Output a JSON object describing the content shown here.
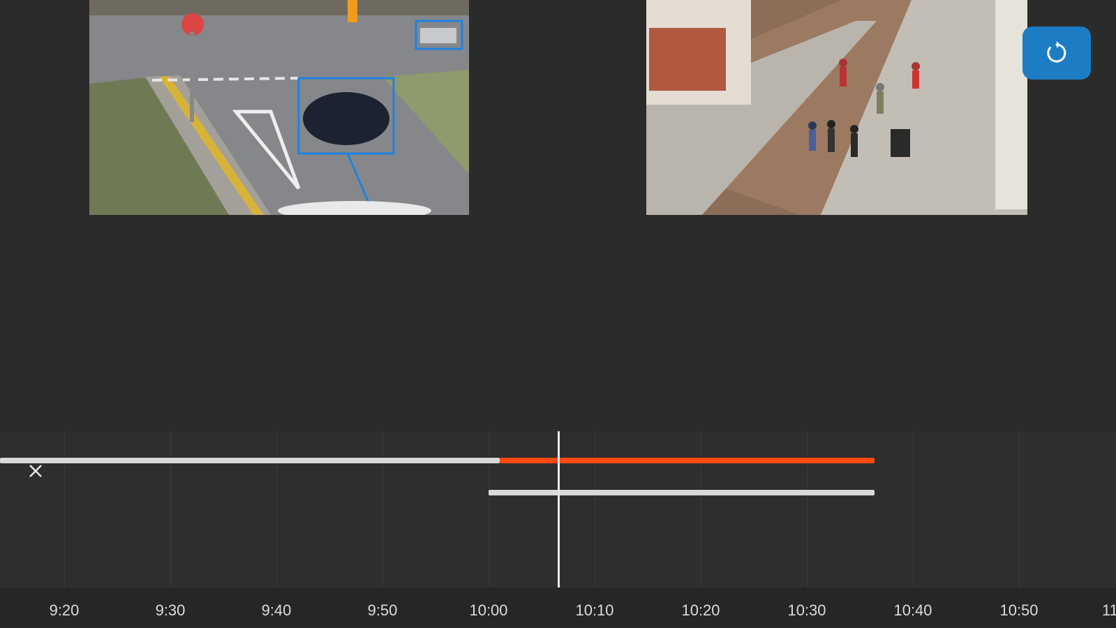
{
  "cameras": {
    "left": {
      "name": "traffic-camera-feed"
    },
    "right": {
      "name": "street-camera-feed"
    }
  },
  "toolbar": {
    "refresh_icon": "refresh-icon",
    "accent": "#1d7dc4"
  },
  "timeline": {
    "tracks": [
      {
        "segments": [
          {
            "start": "09:14",
            "end": "10:01",
            "color": "#d9d9d9"
          },
          {
            "start": "10:01",
            "end": "10:36",
            "color": "#ff4a0f"
          }
        ]
      },
      {
        "segments": [
          {
            "start": "10:00",
            "end": "10:36",
            "color": "#d9d9d9"
          }
        ]
      }
    ],
    "playhead": "10:06",
    "close_icon": "close-icon",
    "ticks": [
      "9:20",
      "9:30",
      "9:40",
      "9:50",
      "10:00",
      "10:10",
      "10:20",
      "10:30",
      "10:40",
      "10:50",
      "11"
    ]
  }
}
